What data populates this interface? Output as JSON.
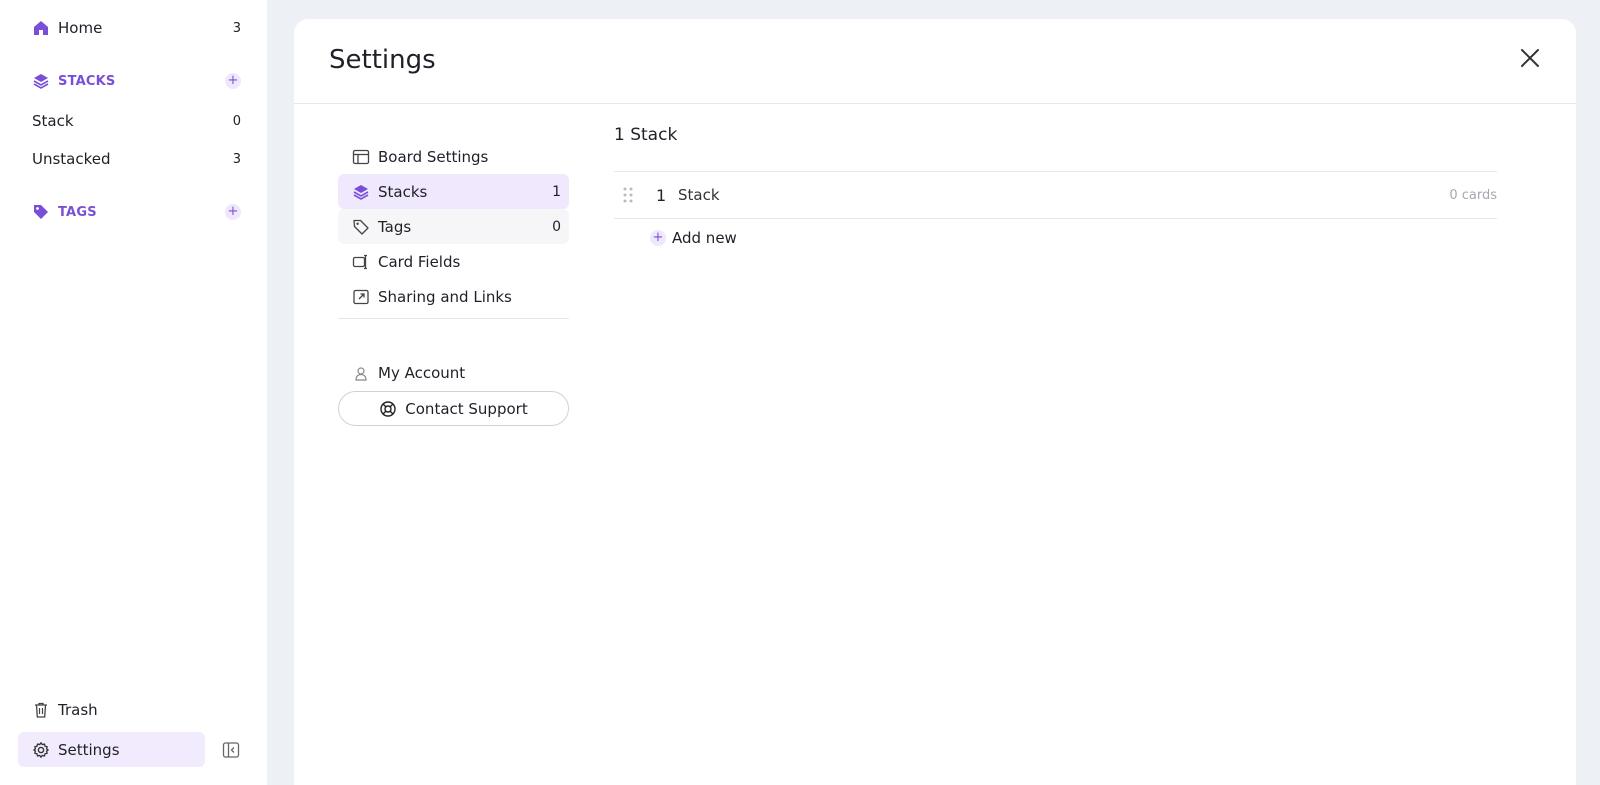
{
  "sidebar": {
    "home": {
      "label": "Home",
      "count": "3"
    },
    "stacks_section": {
      "label": "STACKS"
    },
    "stacks": [
      {
        "label": "Stack",
        "count": "0"
      },
      {
        "label": "Unstacked",
        "count": "3"
      }
    ],
    "tags_section": {
      "label": "TAGS"
    },
    "trash": {
      "label": "Trash"
    },
    "settings": {
      "label": "Settings"
    }
  },
  "modal": {
    "title": "Settings",
    "nav": [
      {
        "label": "Board Settings",
        "count": "",
        "icon": "board-icon"
      },
      {
        "label": "Stacks",
        "count": "1",
        "icon": "layers-icon"
      },
      {
        "label": "Tags",
        "count": "0",
        "icon": "tag-icon"
      },
      {
        "label": "Card Fields",
        "count": "",
        "icon": "card-fields-icon"
      },
      {
        "label": "Sharing and Links",
        "count": "",
        "icon": "external-link-icon"
      }
    ],
    "account": {
      "label": "My Account"
    },
    "support": {
      "label": "Contact Support"
    },
    "content": {
      "title": "1 Stack",
      "rows": [
        {
          "index": "1",
          "name": "Stack",
          "cards": "0 cards"
        }
      ],
      "add_new": "Add new"
    }
  },
  "colors": {
    "accent": "#7a4fd8",
    "active_bg": "#f0e8fd",
    "background": "#edf0f5"
  }
}
